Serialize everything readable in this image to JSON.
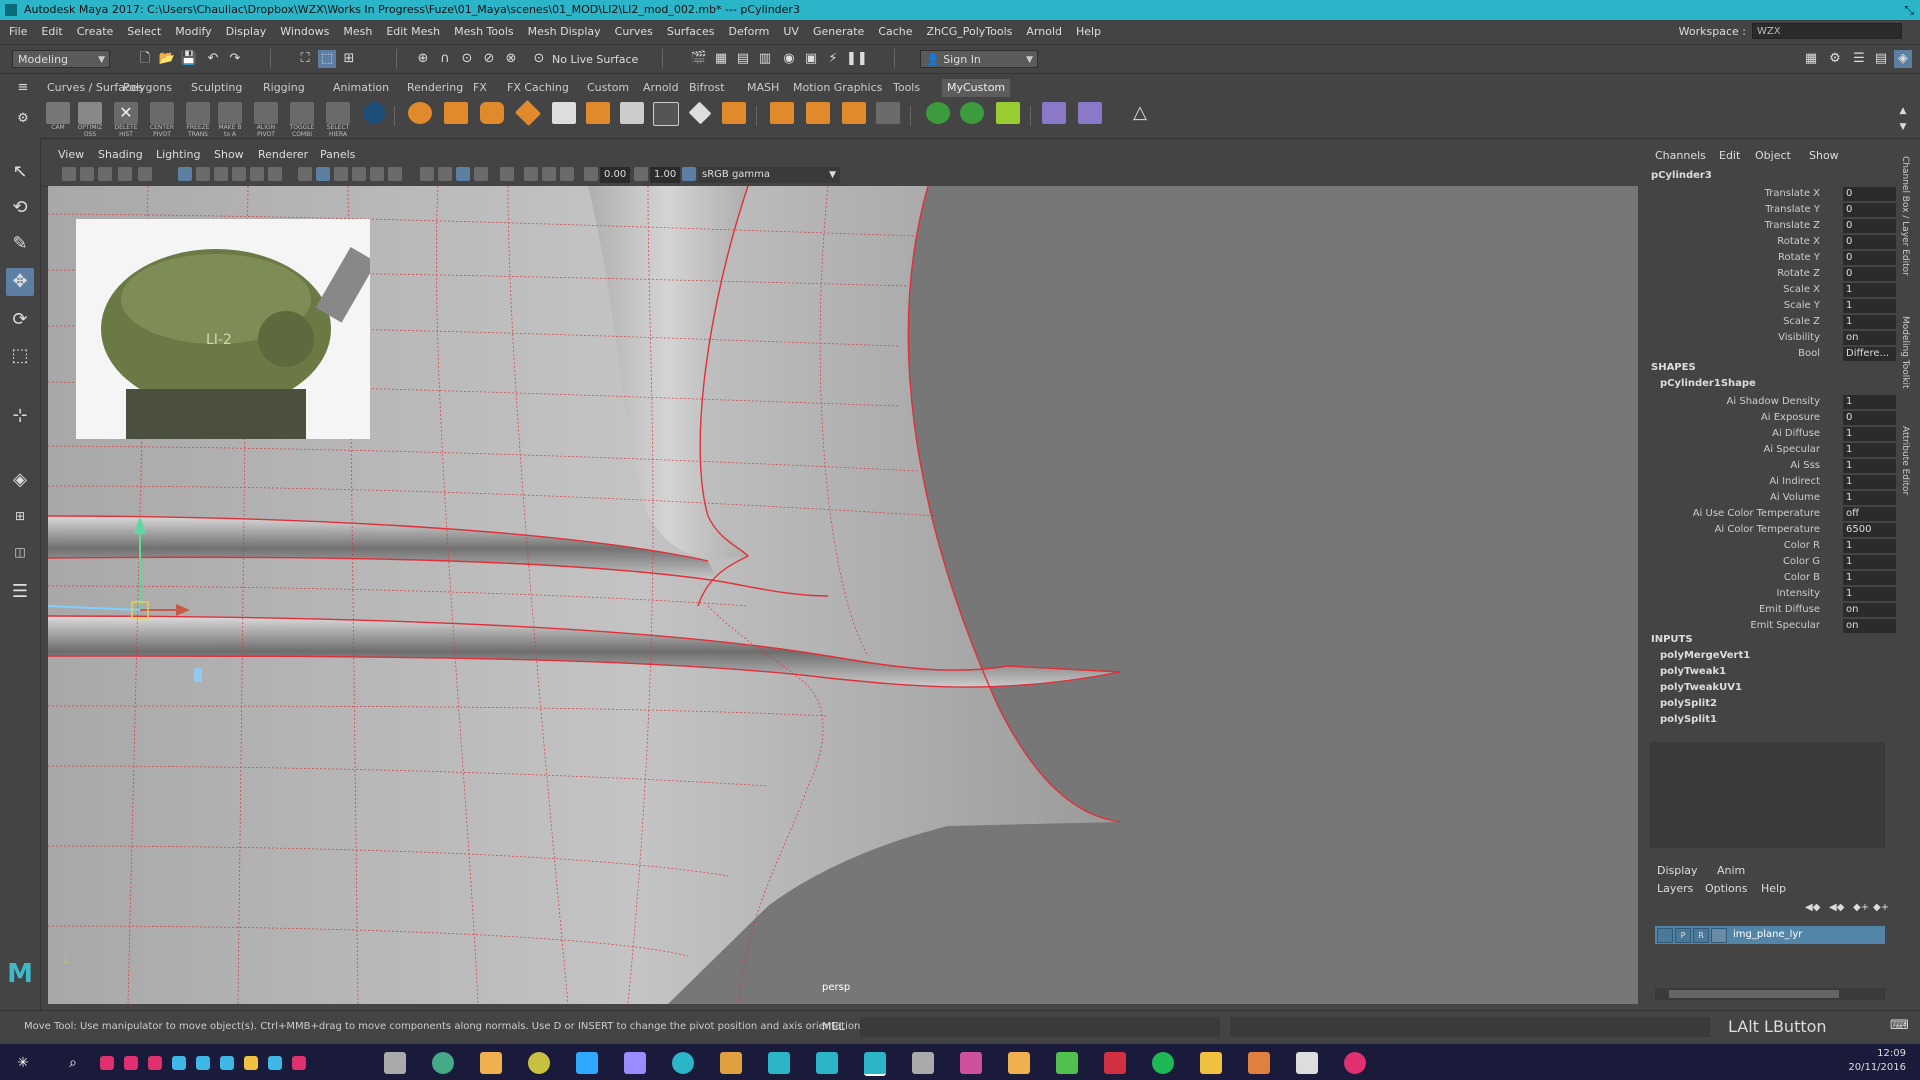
{
  "window": {
    "title": "Autodesk Maya 2017: C:\\Users\\Chauliac\\Dropbox\\WZX\\Works In Progress\\Fuze\\01_Maya\\scenes\\01_MOD\\LI2\\LI2_mod_002.mb*  ---  pCylinder3"
  },
  "menubar": {
    "items": [
      "File",
      "Edit",
      "Create",
      "Select",
      "Modify",
      "Display",
      "Windows",
      "Mesh",
      "Edit Mesh",
      "Mesh Tools",
      "Mesh Display",
      "Curves",
      "Surfaces",
      "Deform",
      "UV",
      "Generate",
      "Cache",
      "ZhCG_PolyTools",
      "Arnold",
      "Help"
    ],
    "workspace_label": "Workspace :",
    "workspace_value": "WZX"
  },
  "statusline": {
    "mode": "Modeling",
    "live_surface": "No Live Surface",
    "sign_in": "Sign In"
  },
  "shelf": {
    "tabs": [
      "Curves / Surfaces",
      "Polygons",
      "Sculpting",
      "Rigging",
      "Animation",
      "Rendering",
      "FX",
      "FX Caching",
      "Custom",
      "Arnold",
      "Bifrost",
      "MASH",
      "Motion Graphics",
      "Tools",
      "MyCustom"
    ],
    "active_tab": "MyCustom",
    "icon_labels": [
      "CAM",
      "OPTIMIZ OSS",
      "DELETE HIST",
      "CENTER PIVOT",
      "FREEZE TRANS",
      "MAKE B to A",
      "ALIGN PIVOT",
      "TOGGLE COMBI",
      "SELECT HIERA"
    ]
  },
  "viewport": {
    "menus": [
      "View",
      "Shading",
      "Lighting",
      "Show",
      "Renderer",
      "Panels"
    ],
    "near_clip": "0.00",
    "far_value": "1.00",
    "color_space": "sRGB gamma",
    "camera": "persp"
  },
  "channelbox": {
    "menus": [
      "Channels",
      "Edit",
      "Object",
      "Show"
    ],
    "object": "pCylinder3",
    "transform": [
      {
        "k": "Translate X",
        "v": "0"
      },
      {
        "k": "Translate Y",
        "v": "0"
      },
      {
        "k": "Translate Z",
        "v": "0"
      },
      {
        "k": "Rotate X",
        "v": "0"
      },
      {
        "k": "Rotate Y",
        "v": "0"
      },
      {
        "k": "Rotate Z",
        "v": "0"
      },
      {
        "k": "Scale X",
        "v": "1"
      },
      {
        "k": "Scale Y",
        "v": "1"
      },
      {
        "k": "Scale Z",
        "v": "1"
      },
      {
        "k": "Visibility",
        "v": "on"
      },
      {
        "k": "Bool",
        "v": "Differe..."
      }
    ],
    "shapes_header": "SHAPES",
    "shape_name": "pCylinder1Shape",
    "shape_attrs": [
      {
        "k": "Ai Shadow Density",
        "v": "1"
      },
      {
        "k": "Ai Exposure",
        "v": "0"
      },
      {
        "k": "Ai Diffuse",
        "v": "1"
      },
      {
        "k": "Ai Specular",
        "v": "1"
      },
      {
        "k": "Ai Sss",
        "v": "1"
      },
      {
        "k": "Ai Indirect",
        "v": "1"
      },
      {
        "k": "Ai Volume",
        "v": "1"
      },
      {
        "k": "Ai Use Color Temperature",
        "v": "off"
      },
      {
        "k": "Ai Color Temperature",
        "v": "6500"
      },
      {
        "k": "Color R",
        "v": "1"
      },
      {
        "k": "Color G",
        "v": "1"
      },
      {
        "k": "Color B",
        "v": "1"
      },
      {
        "k": "Intensity",
        "v": "1"
      },
      {
        "k": "Emit Diffuse",
        "v": "on"
      },
      {
        "k": "Emit Specular",
        "v": "on"
      }
    ],
    "inputs_header": "INPUTS",
    "inputs": [
      "polyMergeVert1",
      "polyTweak1",
      "polyTweakUV1",
      "polySplit2",
      "polySplit1"
    ]
  },
  "sidetabs": [
    "Channel Box / Layer Editor",
    "Modeling Toolkit",
    "Attribute Editor"
  ],
  "layers": {
    "tabs": [
      "Display",
      "Anim"
    ],
    "menus": [
      "Layers",
      "Options",
      "Help"
    ],
    "layer_name": "img_plane_lyr",
    "toggles": [
      "",
      "P",
      "R"
    ]
  },
  "helpline": {
    "text": "Move Tool: Use manipulator to move object(s). Ctrl+MMB+drag to move components along normals. Use D or INSERT to change the pivot position and axis orientation.",
    "mel": "MEL",
    "hotkey": "LAlt LButton"
  },
  "taskbar": {
    "time": "12:09",
    "date": "20/11/2016"
  },
  "colors": {
    "title_bar": "#2bb5c8",
    "active_tool": "#5d7fa3",
    "wireframe": "#e0303a",
    "selected_layer": "#5285a8"
  }
}
